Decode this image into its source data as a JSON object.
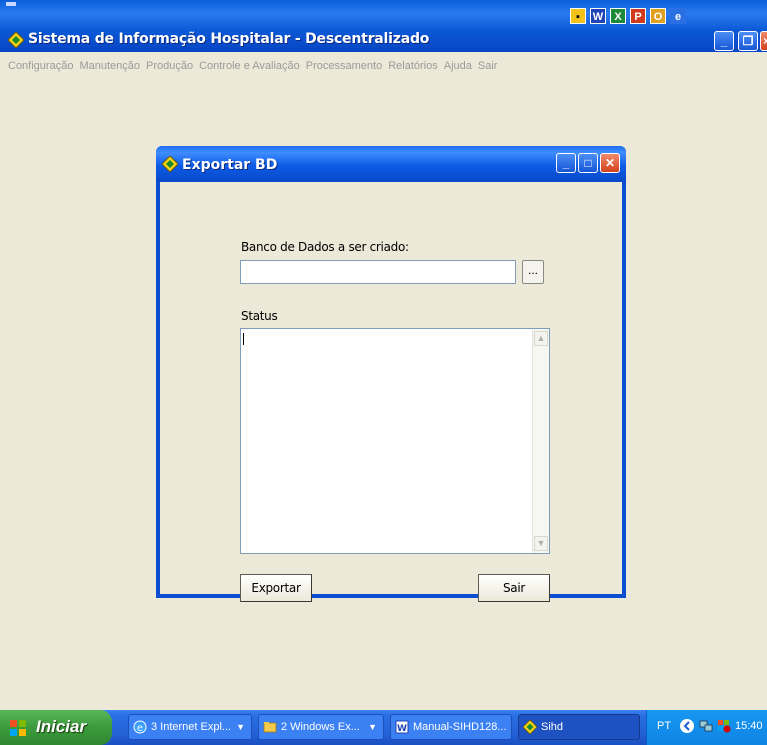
{
  "main_window": {
    "title": "Sistema de Informação Hospitalar - Descentralizado",
    "quick_launch": [
      "excel-like-icon",
      "word-icon",
      "excel-icon",
      "powerpoint-icon",
      "outlook-icon",
      "internet-explorer-icon"
    ],
    "menu": [
      "Configuração",
      "Manutenção",
      "Produção",
      "Controle e Avaliação",
      "Processamento",
      "Relatórios",
      "Ajuda",
      "Sair"
    ]
  },
  "dialog": {
    "title": "Exportar BD",
    "db_label": "Banco de Dados a ser criado:",
    "db_value": "",
    "browse_label": "...",
    "status_label": "Status",
    "status_value": "",
    "export_button": "Exportar",
    "exit_button": "Sair"
  },
  "status_line": "",
  "taskbar": {
    "start_label": "Iniciar",
    "tasks": [
      {
        "label": "3 Internet Expl...",
        "icon": "internet-explorer-icon"
      },
      {
        "label": "2 Windows Ex...",
        "icon": "folder-icon"
      },
      {
        "label": "Manual-SIHD128...",
        "icon": "word-doc-icon"
      },
      {
        "label": "Sihd",
        "icon": "sihd-app-icon"
      }
    ],
    "language": "PT",
    "clock": "15:40"
  },
  "colors": {
    "title_blue": "#0b58d6",
    "start_green": "#3c9a3c",
    "dialog_bg": "#ece9d8"
  }
}
